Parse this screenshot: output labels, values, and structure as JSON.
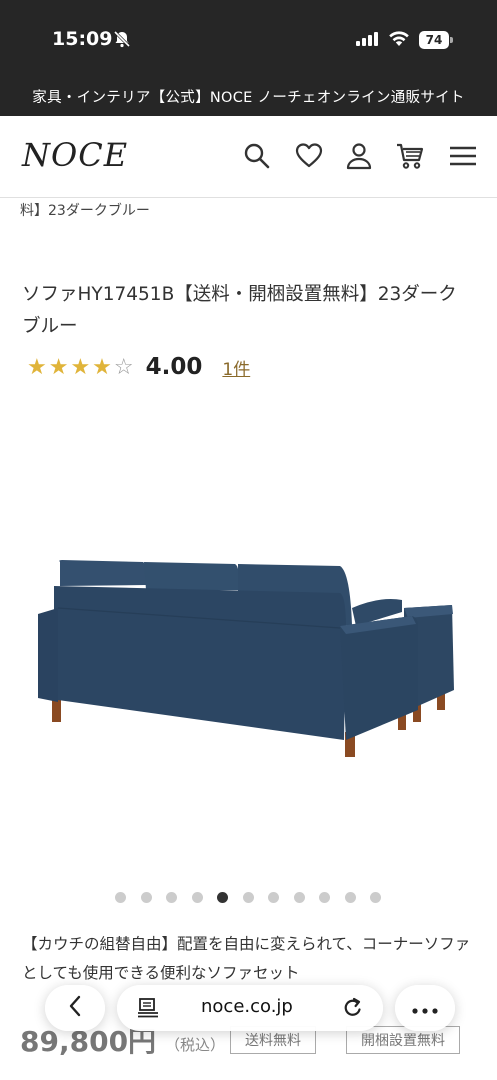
{
  "status_bar": {
    "time": "15:09",
    "battery": "74"
  },
  "site_title": "家具・インテリア【公式】NOCE ノーチェオンライン通販サイト",
  "header": {
    "logo": "NOCE",
    "icons": [
      "search-icon",
      "heart-icon",
      "user-icon",
      "cart-icon",
      "menu-icon"
    ]
  },
  "breadcrumb": "料】23ダークブルー",
  "product": {
    "title": "ソファHY17451B【送料・開梱設置無料】23ダークブルー",
    "rating": {
      "stars": 4,
      "max": 5,
      "value": "4.00",
      "reviews": "1件"
    },
    "image_dots": {
      "count": 11,
      "active_index": 4
    },
    "description": "【カウチの組替自由】配置を自由に変えられて、コーナーソファとしても使用できる便利なソファセット",
    "price": "89,800円",
    "tax": "（税込）",
    "badges": [
      "送料無料",
      "開梱設置無料"
    ]
  },
  "browser": {
    "url": "noce.co.jp",
    "icons": [
      "back-icon",
      "reader-icon",
      "reload-icon",
      "more-icon"
    ]
  },
  "colors": {
    "top_bar": "#262626",
    "star": "#e0b43a",
    "review_link": "#8a6a2b",
    "sofa": "#2f4a66"
  }
}
